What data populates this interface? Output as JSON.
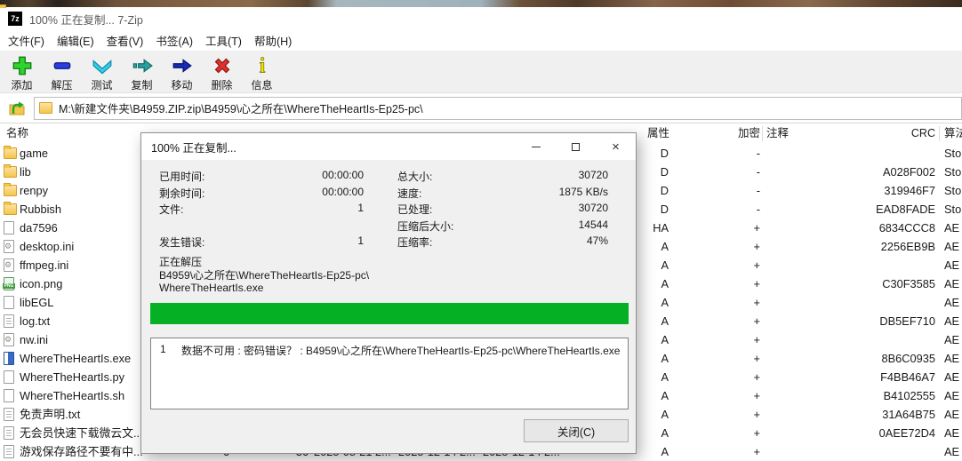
{
  "window": {
    "title": "100% 正在复制... 7-Zip"
  },
  "menu": {
    "items": [
      "文件(F)",
      "编辑(E)",
      "查看(V)",
      "书签(A)",
      "工具(T)",
      "帮助(H)"
    ]
  },
  "toolbar": {
    "items": [
      {
        "label": "添加"
      },
      {
        "label": "解压"
      },
      {
        "label": "测试"
      },
      {
        "label": "复制"
      },
      {
        "label": "移动"
      },
      {
        "label": "删除"
      },
      {
        "label": "信息"
      }
    ]
  },
  "address": {
    "path": "M:\\新建文件夹\\B4959.ZIP.zip\\B4959\\心之所在\\WhereTheHeartIs-Ep25-pc\\"
  },
  "filelist": {
    "columns": {
      "name": "名称",
      "attr": "属性",
      "enc": "加密",
      "comment": "注释",
      "crc": "CRC",
      "method": "算法"
    },
    "rows": [
      {
        "name": "game",
        "icon": "folder",
        "attr": "D",
        "enc": "-",
        "crc": "",
        "method": "Sto"
      },
      {
        "name": "lib",
        "icon": "folder",
        "attr": "D",
        "enc": "-",
        "crc": "A028F002",
        "method": "Sto"
      },
      {
        "name": "renpy",
        "icon": "folder",
        "attr": "D",
        "enc": "-",
        "crc": "319946F7",
        "method": "Sto"
      },
      {
        "name": "Rubbish",
        "icon": "folder",
        "attr": "D",
        "enc": "-",
        "crc": "EAD8FADE",
        "method": "Sto"
      },
      {
        "name": "da7596",
        "icon": "file",
        "attr": "HA",
        "enc": "+",
        "crc": "6834CCC8",
        "method": "AE"
      },
      {
        "name": "desktop.ini",
        "icon": "ini",
        "attr": "A",
        "enc": "+",
        "crc": "2256EB9B",
        "method": "AE"
      },
      {
        "name": "ffmpeg.ini",
        "icon": "ini",
        "attr": "A",
        "enc": "+",
        "crc": "",
        "method": "AE"
      },
      {
        "name": "icon.png",
        "icon": "png",
        "attr": "A",
        "enc": "+",
        "crc": "C30F3585",
        "method": "AE"
      },
      {
        "name": "libEGL",
        "icon": "file",
        "attr": "A",
        "enc": "+",
        "crc": "",
        "method": "AE"
      },
      {
        "name": "log.txt",
        "icon": "txt",
        "attr": "A",
        "enc": "+",
        "crc": "DB5EF710",
        "method": "AE"
      },
      {
        "name": "nw.ini",
        "icon": "ini",
        "attr": "A",
        "enc": "+",
        "crc": "",
        "method": "AE"
      },
      {
        "name": "WhereTheHeartIs.exe",
        "icon": "exe",
        "attr": "A",
        "enc": "+",
        "crc": "8B6C0935",
        "method": "AE"
      },
      {
        "name": "WhereTheHeartIs.py",
        "icon": "file",
        "attr": "A",
        "enc": "+",
        "crc": "F4BB46A7",
        "method": "AE"
      },
      {
        "name": "WhereTheHeartIs.sh",
        "icon": "file",
        "attr": "A",
        "enc": "+",
        "crc": "B4102555",
        "method": "AE"
      },
      {
        "name": "免责声明.txt",
        "icon": "txt",
        "attr": "A",
        "enc": "+",
        "crc": "31A64B75",
        "method": "AE"
      },
      {
        "name": "无会员快速下载微云文...",
        "icon": "txt",
        "attr": "A",
        "enc": "+",
        "crc": "0AEE72D4",
        "method": "AE"
      },
      {
        "name": "游戏保存路径不要有中...",
        "icon": "txt",
        "attr": "A",
        "enc": "+",
        "crc": "",
        "method": "AE",
        "extra": {
          "size": "6",
          "packed": "36",
          "modified": "2025-08-21 2...",
          "created": "2025-12-14 2...",
          "accessed": "2025-12-14 2..."
        }
      }
    ]
  },
  "dialog": {
    "title": "100% 正在复制...",
    "stats_left": [
      {
        "label": "已用时间:",
        "value": "00:00:00"
      },
      {
        "label": "剩余时间:",
        "value": "00:00:00"
      },
      {
        "label": "文件:",
        "value": "1"
      },
      {
        "label": "",
        "value": ""
      },
      {
        "label": "发生错误:",
        "value": "1"
      }
    ],
    "stats_right": [
      {
        "label": "总大小:",
        "value": "30720"
      },
      {
        "label": "速度:",
        "value": "1875 KB/s"
      },
      {
        "label": "已处理:",
        "value": "30720"
      },
      {
        "label": "压缩后大小:",
        "value": "14544"
      },
      {
        "label": "压缩率:",
        "value": "47%"
      }
    ],
    "status": "正在解压",
    "current_path_line1": "B4959\\心之所在\\WhereTheHeartIs-Ep25-pc\\",
    "current_path_line2": "WhereTheHeartIs.exe",
    "progress_percent": 100,
    "error": {
      "num": "1",
      "text": "数据不可用 : 密码错误？ : B4959\\心之所在\\WhereTheHeartIs-Ep25-pc\\WhereTheHeartIs.exe"
    },
    "close_button": "关闭(C)"
  },
  "colors": {
    "progress_green": "#06b025",
    "folder_yellow": "#f3c64e",
    "add_green": "#2fd32f",
    "extract_blue": "#2a3de0",
    "test_cyan": "#35d0e8",
    "copy_teal": "#2e9e9e",
    "move_navy": "#1a2bb8",
    "delete_red": "#e03030",
    "info_yellow": "#f0e000"
  }
}
